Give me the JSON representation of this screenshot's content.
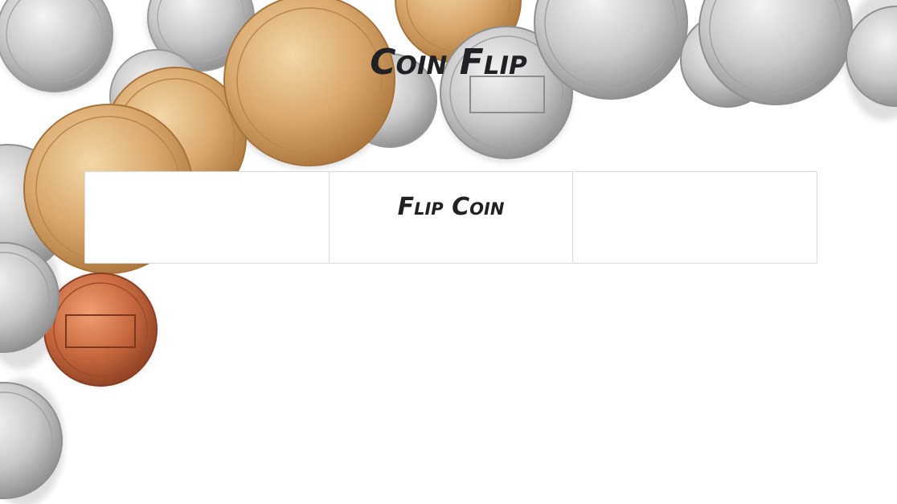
{
  "app": {
    "title": "Coin Flip"
  },
  "panels": {
    "left_result": "",
    "flip_button_label": "Flip Coin",
    "right_result": ""
  },
  "colors": {
    "text": "#1f2124",
    "panel_border": "#d9d9d9",
    "background": "#ffffff",
    "gold_coin": "#d9a86c",
    "silver_coin": "#c9c9c9",
    "copper_coin": "#c8693f"
  }
}
